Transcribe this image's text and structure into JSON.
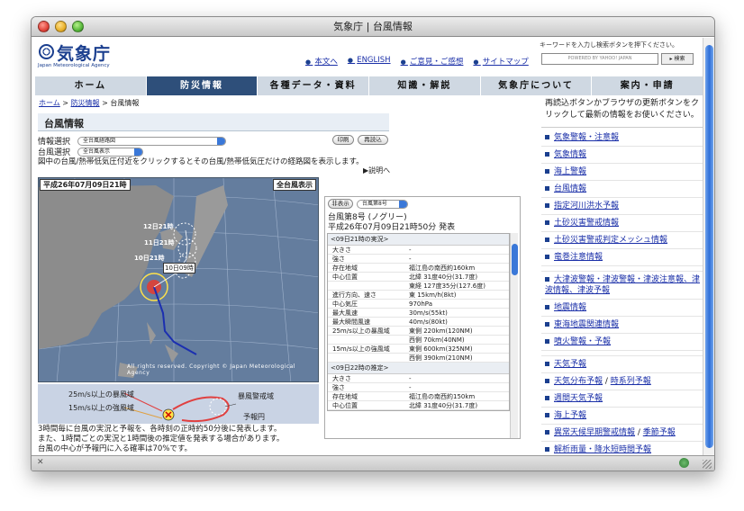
{
  "window": {
    "title": "気象庁 | 台風情報"
  },
  "header": {
    "logo_text": "気象庁",
    "logo_en": "Japan Meteorological Agency",
    "links": [
      "本文へ",
      "ENGLISH",
      "ご意見・ご感想",
      "サイトマップ"
    ],
    "search_hint": "キーワードを入力し検索ボタンを押下ください。",
    "search_placeholder": "POWERED BY YAHOO! JAPAN",
    "search_button": "検索"
  },
  "nav": [
    "ホーム",
    "防災情報",
    "各種データ・資料",
    "知識・解説",
    "気象庁について",
    "案内・申請"
  ],
  "breadcrumb": {
    "home": "ホーム",
    "sep1": " > ",
    "bosai": "防災情報",
    "sep2": " > ",
    "current": "台風情報"
  },
  "page": {
    "title": "台風情報",
    "info_select_label": "情報選択",
    "info_select_value": "全台風経路図",
    "print_button": "印刷",
    "reload_button": "再読込",
    "typhoon_select_label": "台風選択",
    "typhoon_select_value": "全台風表示",
    "instruction": "図中の台風/熱帯低気圧付近をクリックするとその台風/熱帯低気圧だけの経路図を表示します。",
    "explain_link": "▶説明へ"
  },
  "map": {
    "date": "平成26年07月09日21時",
    "show_all": "全台風表示",
    "copyright": "All rights reserved. Copyright © Japan Meteorological Agency",
    "labels": [
      "12日21時",
      "11日21時",
      "10日21時",
      "10日09時"
    ]
  },
  "legend": {
    "storm": "25m/s以上の暴風域",
    "strong": "15m/s以上の強風域",
    "warning": "暴風警戒域",
    "forecast": "予報円"
  },
  "bottom_text": [
    "3時間毎に台風の実況と予報を、各時刻の正時約50分後に発表します。",
    "また、1時間ごとの実況と1時間後の推定値を発表する場合があります。",
    "台風の中心が予報円に入る確率は70%です。"
  ],
  "info": {
    "hide_button": "非表示",
    "select_value": "台風第8号",
    "name": "台風第8号 (ノグリー)",
    "issued": "平成26年07月09日21時50分 発表",
    "section1": "<09日21時の実況>",
    "rows1": [
      [
        "大きさ",
        "-"
      ],
      [
        "強さ",
        "-"
      ],
      [
        "存在地域",
        "福江島の南西約160km"
      ],
      [
        "中心位置",
        "北緯 31度40分(31.7度)"
      ],
      [
        "",
        "東経 127度35分(127.6度)"
      ],
      [
        "進行方向、速さ",
        "東 15km/h(8kt)"
      ],
      [
        "中心気圧",
        "970hPa"
      ],
      [
        "最大風速",
        "30m/s(55kt)"
      ],
      [
        "最大瞬間風速",
        "40m/s(80kt)"
      ],
      [
        "25m/s以上の暴風域",
        "東側 220km(120NM)"
      ],
      [
        "",
        "西側 70km(40NM)"
      ],
      [
        "15m/s以上の強風域",
        "東側 600km(325NM)"
      ],
      [
        "",
        "西側 390km(210NM)"
      ]
    ],
    "section2": "<09日22時の推定>",
    "rows2": [
      [
        "大きさ",
        "-"
      ],
      [
        "強さ",
        "-"
      ],
      [
        "存在地域",
        "福江島の南西約150km"
      ],
      [
        "中心位置",
        "北緯 31度40分(31.7度)"
      ]
    ]
  },
  "right": {
    "notice": "再読込ボタンかブラウザの更新ボタンをクリックして最新の情報をお使いください。",
    "links": [
      [
        "気象警報・注意報"
      ],
      [
        "気象情報"
      ],
      [
        "海上警報"
      ],
      [
        "台風情報"
      ],
      [
        "指定河川洪水予報"
      ],
      [
        "土砂災害警戒情報"
      ],
      [
        "土砂災害警戒判定メッシュ情報"
      ],
      [
        "竜巻注意情報"
      ],
      [
        "大津波警報・津波警報・津波注意報、津波情報、津波予報"
      ],
      [
        "地震情報"
      ],
      [
        "東海地震関連情報"
      ],
      [
        "噴火警報・予報"
      ],
      [
        "天気予報"
      ],
      [
        "天気分布予報",
        "時系列予報"
      ],
      [
        "週間天気予報"
      ],
      [
        "海上予報"
      ],
      [
        "異常天候早期警戒情報",
        "季節予報"
      ],
      [
        "解析雨量・降水短時間予報"
      ]
    ]
  }
}
